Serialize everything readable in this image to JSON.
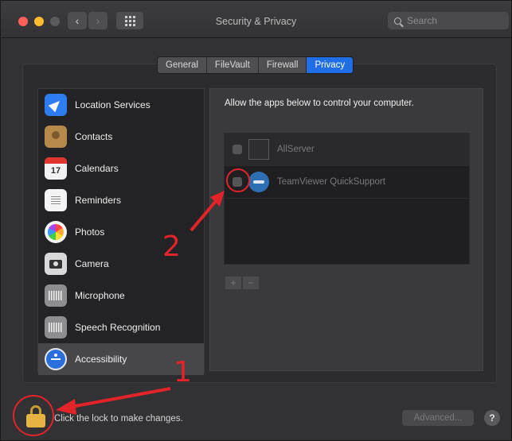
{
  "window": {
    "title": "Security & Privacy"
  },
  "search": {
    "placeholder": "Search"
  },
  "tabs": [
    {
      "label": "General"
    },
    {
      "label": "FileVault"
    },
    {
      "label": "Firewall"
    },
    {
      "label": "Privacy",
      "active": true
    }
  ],
  "sidebar": {
    "items": [
      {
        "label": "Location Services",
        "icon": "location-arrow-icon"
      },
      {
        "label": "Contacts",
        "icon": "contacts-book-icon"
      },
      {
        "label": "Calendars",
        "icon": "calendar-icon",
        "icon_text": "17"
      },
      {
        "label": "Reminders",
        "icon": "reminders-list-icon"
      },
      {
        "label": "Photos",
        "icon": "photos-flower-icon"
      },
      {
        "label": "Camera",
        "icon": "camera-icon"
      },
      {
        "label": "Microphone",
        "icon": "microphone-waveform-icon"
      },
      {
        "label": "Speech Recognition",
        "icon": "speech-waveform-icon"
      },
      {
        "label": "Accessibility",
        "icon": "accessibility-icon",
        "selected": true
      }
    ]
  },
  "main": {
    "heading": "Allow the apps below to control your computer.",
    "apps": [
      {
        "name": "AllServer",
        "checked": false
      },
      {
        "name": "TeamViewer QuickSupport",
        "checked": false
      }
    ],
    "add_label": "+",
    "remove_label": "−"
  },
  "footer": {
    "lock_text": "Click the lock to make changes.",
    "advanced_label": "Advanced...",
    "help_label": "?"
  },
  "annotations": {
    "step1": "1",
    "step2": "2"
  },
  "colors": {
    "accent": "#1f6ee6",
    "annotation": "#e0242a",
    "lock": "#e7b444"
  }
}
